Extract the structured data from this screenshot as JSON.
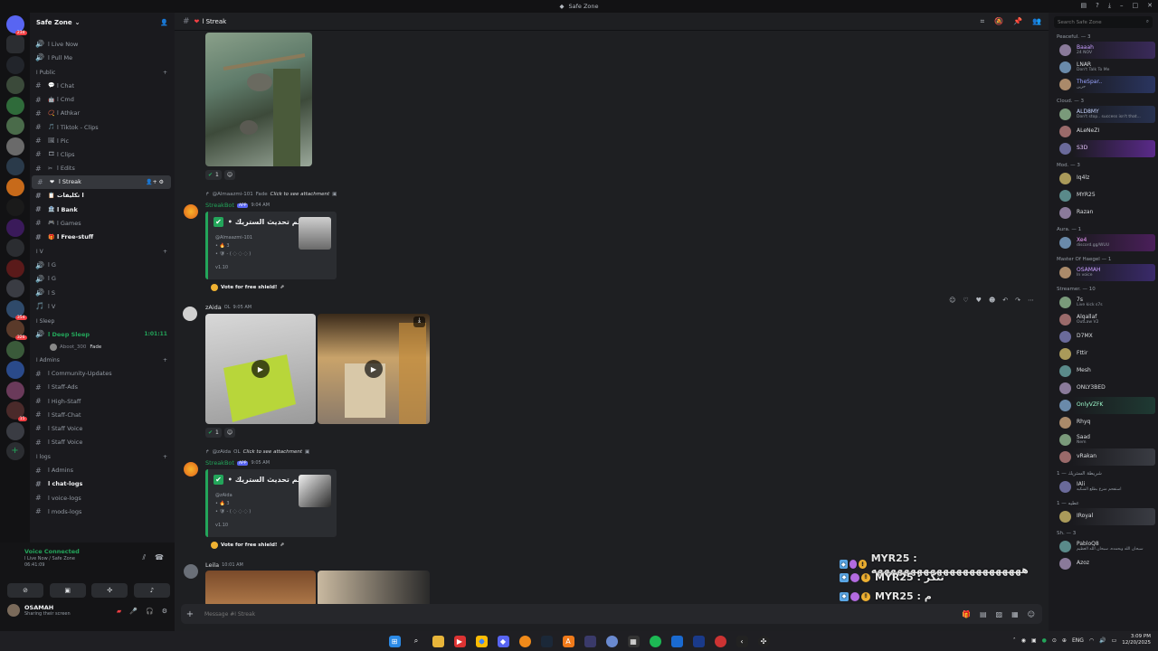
{
  "window": {
    "title": "Safe Zone"
  },
  "server": {
    "name": "Safe Zone"
  },
  "channels_top": [
    {
      "name": "ا Live Now",
      "emoji": "🔊"
    },
    {
      "name": "ا Pull Me",
      "emoji": "🔊"
    }
  ],
  "categories": {
    "public": "ا Public",
    "v": "ا V",
    "sleep": "ا Sleep",
    "admins": "ا Admins",
    "logs": "ا logs"
  },
  "public_channels": [
    {
      "name": "ا Chat",
      "emoji": "💬"
    },
    {
      "name": "ا Cmd",
      "emoji": "🤖"
    },
    {
      "name": "ا Athkar",
      "emoji": "📿"
    },
    {
      "name": "ا Tiktok - Clips",
      "emoji": "🎵"
    },
    {
      "name": "ا Pic",
      "emoji": "🖼"
    },
    {
      "name": "ا Clips",
      "emoji": "🎞"
    },
    {
      "name": "ا Edits",
      "emoji": "✂"
    },
    {
      "name": "ا Streak",
      "emoji": "❤"
    },
    {
      "name": "ا تكليفات",
      "emoji": "📋"
    },
    {
      "name": "ا Bank",
      "emoji": "🏦"
    },
    {
      "name": "ا Games",
      "emoji": "🎮"
    },
    {
      "name": "ا Free-stuff",
      "emoji": "🎁"
    }
  ],
  "v_channels": [
    {
      "name": "ا G",
      "emoji": "🔊"
    },
    {
      "name": "ا G",
      "emoji": "🔊"
    },
    {
      "name": "ا S",
      "emoji": "🔊"
    },
    {
      "name": "ا V",
      "emoji": "🎵"
    }
  ],
  "sleep": {
    "channel": "ا Deep Sleep",
    "timer": "1:01:11",
    "user": "Aboot_300",
    "user_tag": "Fade"
  },
  "admin_channels": [
    {
      "name": "ا Community-Updates"
    },
    {
      "name": "ا Staff-Ads"
    },
    {
      "name": "ا High-Staff"
    },
    {
      "name": "ا Staff-Chat"
    },
    {
      "name": "ا Staff Voice"
    },
    {
      "name": "ا Staff Voice"
    }
  ],
  "log_channels": [
    {
      "name": "ا Admins"
    },
    {
      "name": "ا chat-logs"
    },
    {
      "name": "ا voice-logs"
    },
    {
      "name": "ا mods-logs"
    }
  ],
  "voice_panel": {
    "status": "Voice Connected",
    "location": "ا Live Now / Safe Zone",
    "elapsed": "06:41:09"
  },
  "user": {
    "name": "OSAMAH",
    "status": "Sharing their screen"
  },
  "header": {
    "channel": "ا Streak"
  },
  "messages": {
    "reaction_count_1": "1",
    "reaction_count_2": "1",
    "reply1_user": "@Almaazmi-101",
    "reply1_tag": "Fade",
    "reply_prompt": "Click to see attachment",
    "bot_name": "StreakBot",
    "bot_badge": "APP",
    "bot_time1": "9:04 AM",
    "embed_title": "تم تحديث الستريك •",
    "embed1_user": "@Almaazmi-101",
    "embed_streak": "3",
    "embed_version": "v1.10",
    "vote": "Vote for free shield!",
    "aida_name": "zAida",
    "aida_tag": "OL",
    "aida_time": "9:05 AM",
    "reply2_user": "@zAida",
    "reply2_tag": "OL",
    "bot_time2": "9:05 AM",
    "embed2_user": "@zAida",
    "leila_name": "Leila",
    "leila_time": "10:01 AM"
  },
  "overlay_lines": [
    "MYR25 : هههههههههههههههههههههههه",
    "MYR25 : تتكر",
    "MYR25 : م"
  ],
  "composer": {
    "placeholder": "Message #ا Streak"
  },
  "member_search": {
    "placeholder": "Search Safe Zone"
  },
  "member_groups": [
    {
      "title": "Peaceful. — 3",
      "members": [
        {
          "name": "Baaah",
          "status": "24 NOV",
          "color": "#c9a0ff",
          "bg": "#3a2a5a"
        },
        {
          "name": "LNAR",
          "status": "Don't Talk To Me",
          "color": "#dbdee1",
          "bg": ""
        },
        {
          "name": "TheSpar..",
          "status": "حزين",
          "color": "#9aa4ff",
          "bg": "#2a3560"
        }
      ]
    },
    {
      "title": "Cloud. — 3",
      "members": [
        {
          "name": "ALD8MY",
          "status": "Don't stop.. success isn't that...",
          "color": "#c9d6ff",
          "bg": "#27314f"
        },
        {
          "name": "ALeNeZI",
          "status": "",
          "color": "#dbdee1",
          "bg": ""
        },
        {
          "name": "S3D",
          "status": "",
          "color": "#e9c6ff",
          "bg": "#5a2a8a"
        }
      ]
    },
    {
      "title": "Mod. — 3",
      "members": [
        {
          "name": "Iq4lz",
          "status": "",
          "color": "#dbdee1",
          "bg": ""
        },
        {
          "name": "MYR25",
          "status": "",
          "color": "#dbdee1",
          "bg": ""
        },
        {
          "name": "Razan",
          "status": "",
          "color": "#dbdee1",
          "bg": ""
        }
      ]
    },
    {
      "title": "Aura. — 1",
      "members": [
        {
          "name": "Xe4",
          "status": "discord.gg/WUU",
          "color": "#f2a0ff",
          "bg": "#4a1f5a"
        }
      ]
    },
    {
      "title": "Master Of Haegel — 1",
      "members": [
        {
          "name": "OSAMAH",
          "status": "In voice",
          "color": "#c9a0ff",
          "bg": "#3a2a6a"
        }
      ]
    },
    {
      "title": "Streamer. — 10",
      "members": [
        {
          "name": "7s",
          "status": "Live kick s7s",
          "color": "#dbdee1",
          "bg": ""
        },
        {
          "name": "Alqallaf",
          "status": "OutLaw V2",
          "color": "#dbdee1",
          "bg": ""
        },
        {
          "name": "D7MX",
          "status": "",
          "color": "#dbdee1",
          "bg": ""
        },
        {
          "name": "Fttir",
          "status": "",
          "color": "#dbdee1",
          "bg": ""
        },
        {
          "name": "Mesh",
          "status": "",
          "color": "#dbdee1",
          "bg": ""
        },
        {
          "name": "ONLY3BED",
          "status": "",
          "color": "#dbdee1",
          "bg": ""
        },
        {
          "name": "OnlyVZFK",
          "status": "",
          "color": "#a0ffd0",
          "bg": "#1f3a33"
        },
        {
          "name": "Rhyq",
          "status": "",
          "color": "#dbdee1",
          "bg": ""
        },
        {
          "name": "Saad",
          "status": "Nem",
          "color": "#dbdee1",
          "bg": ""
        },
        {
          "name": "vRakan",
          "status": "",
          "color": "#dbdee1",
          "bg": "#3a3c43"
        }
      ]
    },
    {
      "title": "شريطة الستريك — 1",
      "members": [
        {
          "name": "IAli",
          "status": "استفحم منزع بطلع الشكيه",
          "color": "#dbdee1",
          "bg": ""
        }
      ]
    },
    {
      "title": "عطيه — 1",
      "members": [
        {
          "name": "IRoyal",
          "status": "",
          "color": "#dbdee1",
          "bg": "#3a3c43"
        }
      ]
    },
    {
      "title": "Sh. — 3",
      "members": [
        {
          "name": "PabloQ8",
          "status": "سبحان الله وبحمده، سبحان الله العظيم",
          "color": "#dbdee1",
          "bg": ""
        },
        {
          "name": "Azoz",
          "status": "",
          "color": "#dbdee1",
          "bg": ""
        }
      ]
    }
  ],
  "tray": {
    "lang": "ENG",
    "time": "3:09 PM",
    "date": "12/20/2025"
  }
}
